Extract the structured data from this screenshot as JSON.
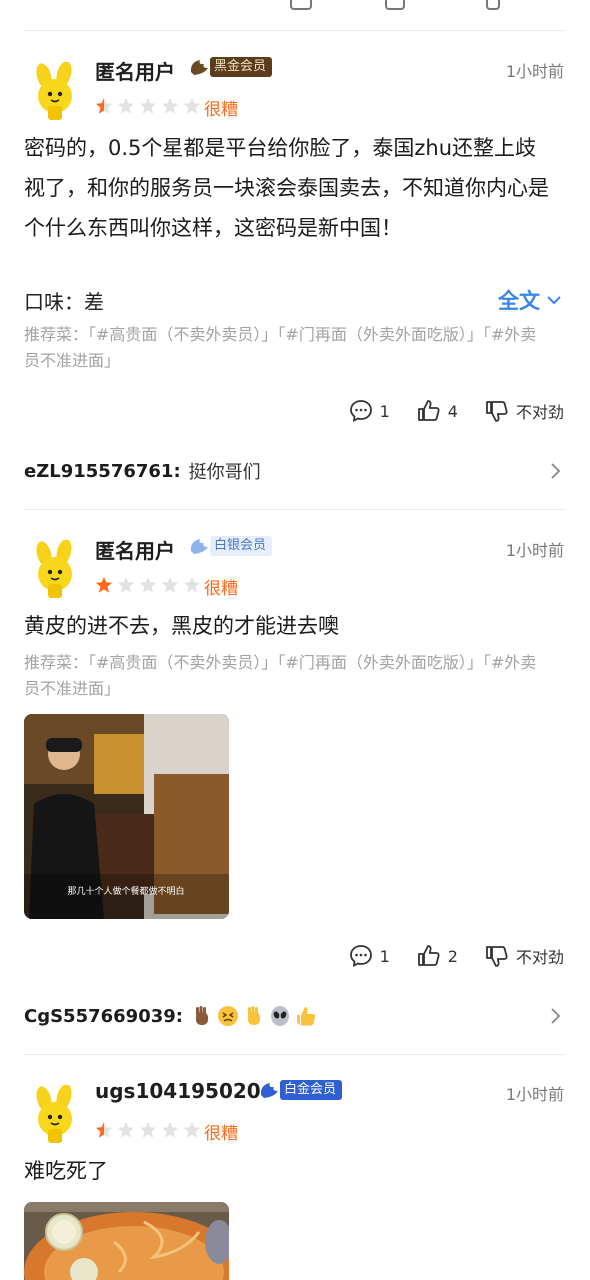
{
  "colors": {
    "accent_orange": "#ff6a1a",
    "link_blue": "#3a86e8",
    "muted": "#a3a3a3",
    "divider": "#ececec"
  },
  "reviews": [
    {
      "username": "匿名用户",
      "badge": {
        "label": "黑金会员",
        "style": "black"
      },
      "time": "1小时前",
      "rating": {
        "stars": 0.5,
        "max": 5,
        "label": "很糟"
      },
      "content": "密码的，0.5个星都是平台给你脸了，泰国zhu还整上歧视了，和你的服务员一块滚会泰国卖去，不知道你内心是个什么东西叫你这样，这密码是新中国！",
      "taste": "口味：差",
      "fulltext": "全文",
      "recommend": "推荐菜：「#高贵面（不卖外卖员）」「#门再面（外卖外面吃版）」「#外卖员不准进面」",
      "actions": {
        "comments": "1",
        "likes": "4",
        "dislike": "不对劲"
      },
      "reply": {
        "user": "eZL915576761:",
        "text": "挺你哥们"
      }
    },
    {
      "username": "匿名用户",
      "badge": {
        "label": "白银会员",
        "style": "silver"
      },
      "time": "1小时前",
      "rating": {
        "stars": 1,
        "max": 5,
        "label": "很糟"
      },
      "content": "黄皮的进不去，黑皮的才能进去噢",
      "recommend": "推荐菜：「#高贵面（不卖外卖员）」「#门再面（外卖外面吃版）」「#外卖员不准进面」",
      "photo_caption": "那几十个人做个餐都做不明白",
      "actions": {
        "comments": "1",
        "likes": "2",
        "dislike": "不对劲"
      },
      "reply": {
        "user": "CgS557669039:",
        "emojis": [
          "raised-hand-dark",
          "persevering-face",
          "raised-hand",
          "alien-face",
          "thumbs-up"
        ]
      }
    },
    {
      "username": "ugs104195020",
      "badge": {
        "label": "白金会员",
        "style": "plat"
      },
      "time": "1小时前",
      "rating": {
        "stars": 0.5,
        "max": 5,
        "label": "很糟"
      },
      "content": "难吃死了"
    }
  ]
}
